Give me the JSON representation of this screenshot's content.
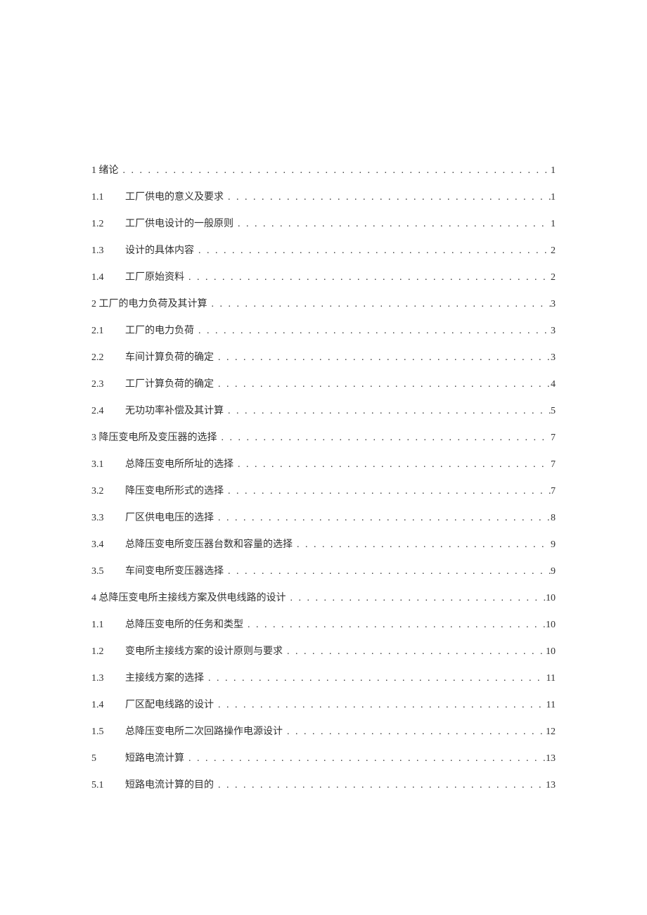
{
  "toc": [
    {
      "type": "chapter",
      "num": "1",
      "title": "绪论",
      "page": "1"
    },
    {
      "type": "section",
      "num": "1.1",
      "title": "工厂供电的意义及要求",
      "page": "1"
    },
    {
      "type": "section",
      "num": "1.2",
      "title": "工厂供电设计的一般原则",
      "page": "1"
    },
    {
      "type": "section",
      "num": "1.3",
      "title": "设计的具体内容",
      "page": "2"
    },
    {
      "type": "section",
      "num": "1.4",
      "title": "工厂原始资料",
      "page": "2"
    },
    {
      "type": "chapter",
      "num": "2",
      "title": "工厂的电力负荷及其计算",
      "page": "3"
    },
    {
      "type": "section",
      "num": "2.1",
      "title": "工厂的电力负荷",
      "page": "3"
    },
    {
      "type": "section",
      "num": "2.2",
      "title": "车间计算负荷的确定",
      "page": "3"
    },
    {
      "type": "section",
      "num": "2.3",
      "title": "工厂计算负荷的确定",
      "page": "4"
    },
    {
      "type": "section",
      "num": "2.4",
      "title": "无功功率补偿及其计算",
      "page": "5"
    },
    {
      "type": "chapter",
      "num": "3",
      "title": "降压变电所及变压器的选择",
      "page": "7"
    },
    {
      "type": "section",
      "num": "3.1",
      "title": "总降压变电所所址的选择",
      "page": "7"
    },
    {
      "type": "section",
      "num": "3.2",
      "title": "降压变电所形式的选择",
      "page": "7"
    },
    {
      "type": "section",
      "num": "3.3",
      "title": "厂区供电电压的选择",
      "page": "8"
    },
    {
      "type": "section",
      "num": "3.4",
      "title": "总降压变电所变压器台数和容量的选择",
      "page": "9"
    },
    {
      "type": "section",
      "num": "3.5",
      "title": "车间变电所变压器选择",
      "page": "9"
    },
    {
      "type": "chapter",
      "num": "4",
      "title": "总降压变电所主接线方案及供电线路的设计",
      "page": "10"
    },
    {
      "type": "section",
      "num": "1.1",
      "title": "总降压变电所的任务和类型",
      "page": "10"
    },
    {
      "type": "section",
      "num": "1.2",
      "title": "变电所主接线方案的设计原则与要求",
      "page": "10"
    },
    {
      "type": "section",
      "num": "1.3",
      "title": "主接线方案的选择",
      "page": "11"
    },
    {
      "type": "section",
      "num": "1.4",
      "title": "厂区配电线路的设计",
      "page": "11"
    },
    {
      "type": "section",
      "num": "1.5",
      "title": "总降压变电所二次回路操作电源设计",
      "page": "12"
    },
    {
      "type": "section",
      "num": "5",
      "title": "短路电流计算",
      "page": "13"
    },
    {
      "type": "section",
      "num": "5.1",
      "title": "短路电流计算的目的",
      "page": "13"
    }
  ]
}
